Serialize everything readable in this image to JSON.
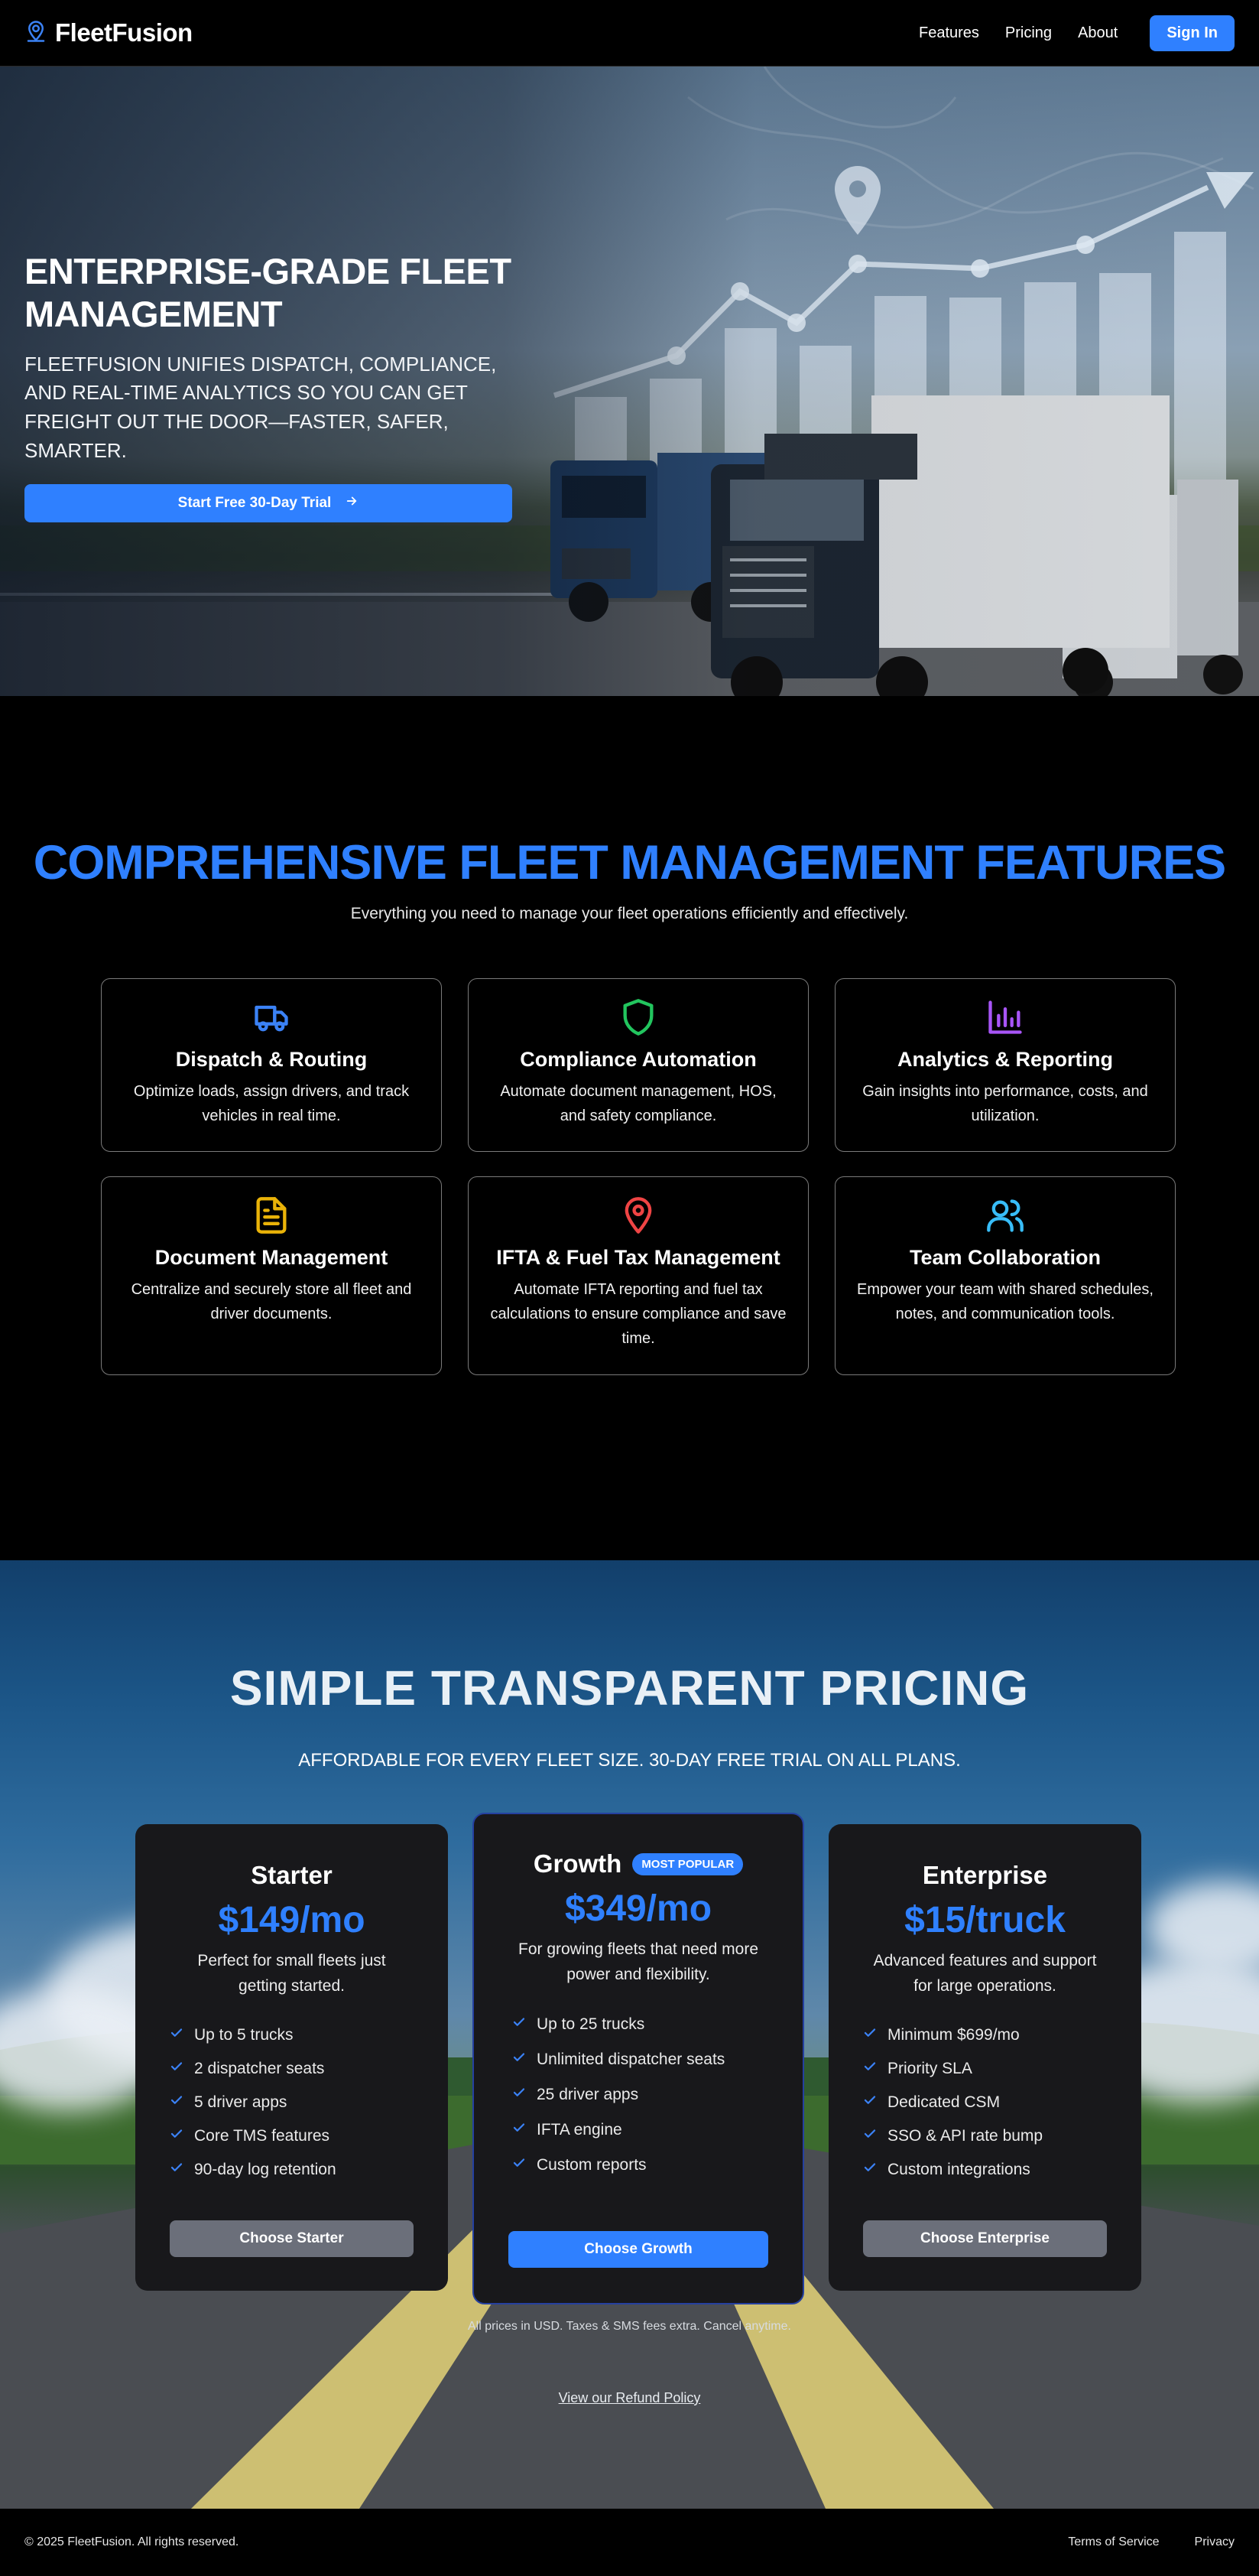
{
  "nav": {
    "brand": "FleetFusion",
    "links": [
      "Features",
      "Pricing",
      "About"
    ],
    "signin": "Sign In"
  },
  "hero": {
    "title": "ENTERPRISE-GRADE FLEET MANAGEMENT",
    "subtitle": "FLEETFUSION UNIFIES DISPATCH, COMPLIANCE, AND REAL-TIME ANALYTICS SO YOU CAN GET FREIGHT OUT THE DOOR—FASTER, SAFER, SMARTER.",
    "cta": "Start Free 30-Day Trial"
  },
  "features": {
    "title": "COMPREHENSIVE FLEET MANAGEMENT FEATURES",
    "subtitle": "Everything you need to manage your fleet operations efficiently and effectively.",
    "items": [
      {
        "icon": "truck-icon",
        "color": "#3b82f6",
        "title": "Dispatch & Routing",
        "desc": "Optimize loads, assign drivers, and track vehicles in real time."
      },
      {
        "icon": "shield-icon",
        "color": "#22c55e",
        "title": "Compliance Automation",
        "desc": "Automate document management, HOS, and safety compliance."
      },
      {
        "icon": "bar-chart-icon",
        "color": "#a855f7",
        "title": "Analytics & Reporting",
        "desc": "Gain insights into performance, costs, and utilization."
      },
      {
        "icon": "document-icon",
        "color": "#eab308",
        "title": "Document Management",
        "desc": "Centralize and securely store all fleet and driver documents."
      },
      {
        "icon": "map-pin-icon",
        "color": "#ef4444",
        "title": "IFTA & Fuel Tax Management",
        "desc": "Automate IFTA reporting and fuel tax calculations to ensure compliance and save time."
      },
      {
        "icon": "users-icon",
        "color": "#38bdf8",
        "title": "Team Collaboration",
        "desc": "Empower your team with shared schedules, notes, and communication tools."
      }
    ]
  },
  "pricing": {
    "title": "SIMPLE TRANSPARENT PRICING",
    "subtitle": "AFFORDABLE FOR EVERY FLEET SIZE. 30-DAY FREE TRIAL ON ALL PLANS.",
    "plans": [
      {
        "name": "Starter",
        "badge": "",
        "price": "$149/mo",
        "desc": "Perfect for small fleets just getting started.",
        "features": [
          "Up to 5 trucks",
          "2 dispatcher seats",
          "5 driver apps",
          "Core TMS features",
          "90-day log retention"
        ],
        "button": "Choose Starter"
      },
      {
        "name": "Growth",
        "badge": "MOST POPULAR",
        "price": "$349/mo",
        "desc": "For growing fleets that need more power and flexibility.",
        "features": [
          "Up to 25 trucks",
          "Unlimited dispatcher seats",
          "25 driver apps",
          "IFTA engine",
          "Custom reports"
        ],
        "button": "Choose Growth"
      },
      {
        "name": "Enterprise",
        "badge": "",
        "price": "$15/truck",
        "desc": "Advanced features and support for large operations.",
        "features": [
          "Minimum $699/mo",
          "Priority SLA",
          "Dedicated CSM",
          "SSO & API rate bump",
          "Custom integrations"
        ],
        "button": "Choose Enterprise"
      }
    ],
    "fine_print": "All prices in USD. Taxes & SMS fees extra. Cancel anytime.",
    "refund_link": "View our Refund Policy"
  },
  "footer": {
    "copyright": "© 2025 FleetFusion. All rights reserved.",
    "links": [
      "Terms of Service",
      "Privacy"
    ]
  },
  "colors": {
    "accent": "#2f80ff",
    "card_bg": "#18181b"
  }
}
